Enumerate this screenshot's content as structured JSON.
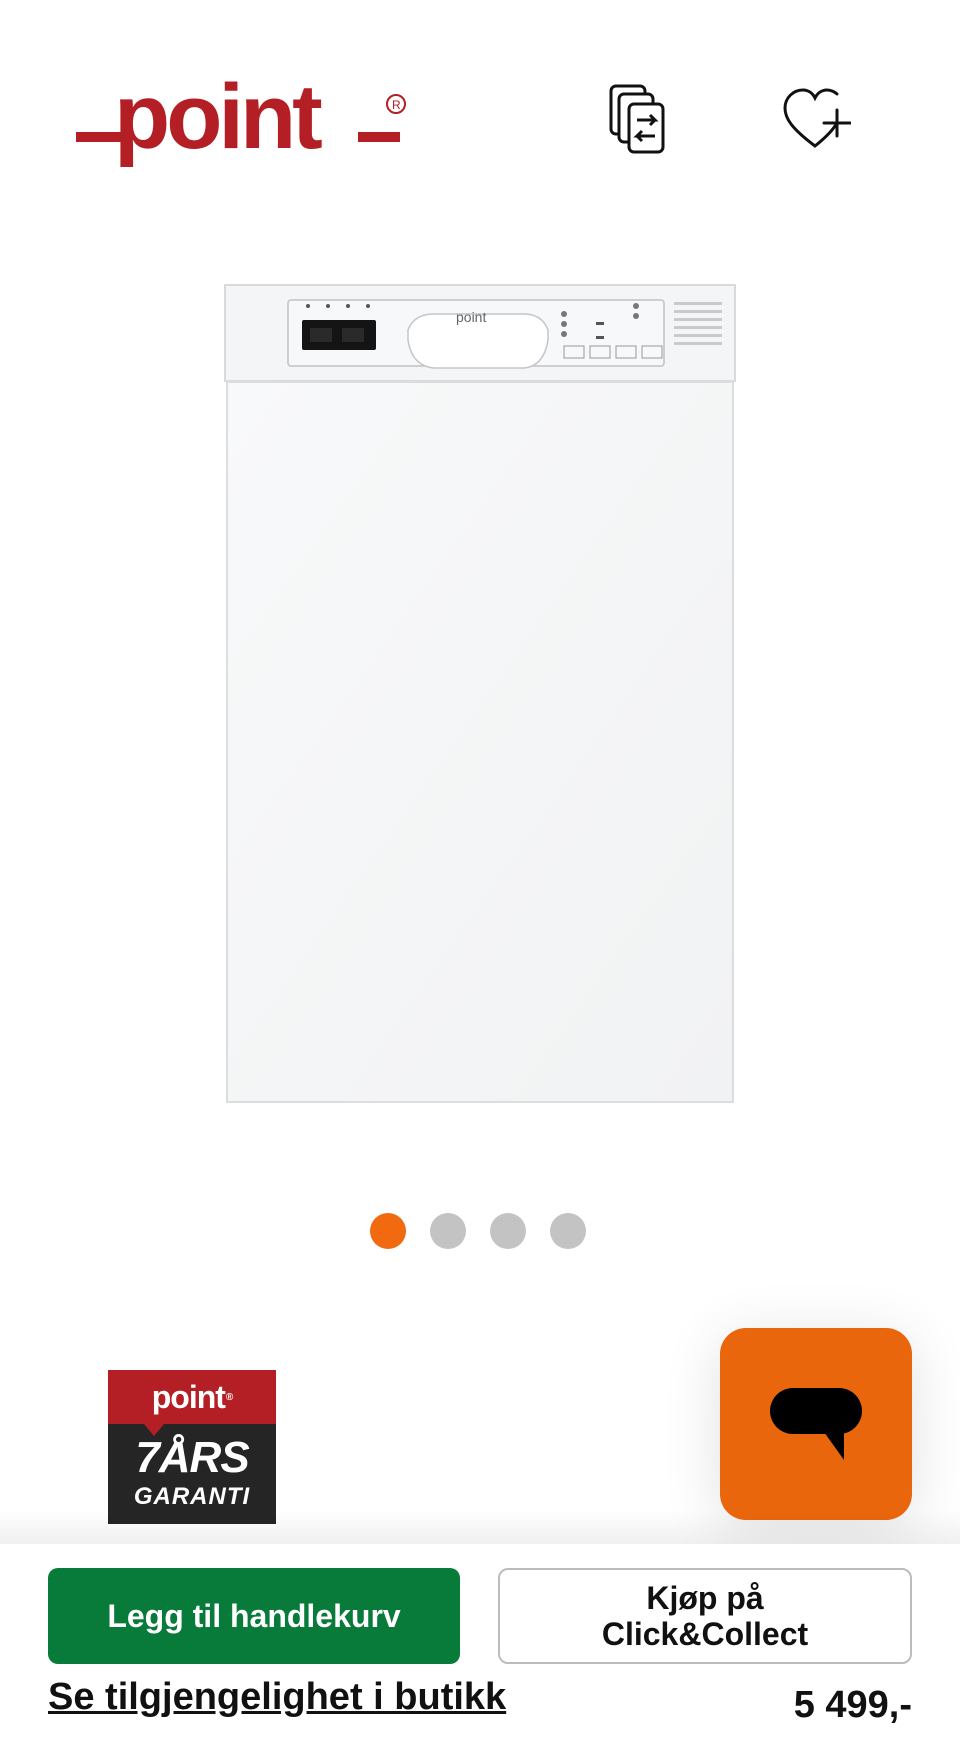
{
  "header": {
    "logo_text": "point",
    "brand_color": "#b31f24",
    "compare_icon": "compare-icon",
    "wishlist_icon": "heart-plus-icon"
  },
  "gallery": {
    "image_label_text": "point",
    "dot_count": 4,
    "active_dot": 1,
    "active_color": "#f26a10",
    "inactive_color": "#c3c3c3"
  },
  "badge": {
    "brand": "point",
    "years": "7ÅRS",
    "garanti": "GARANTI"
  },
  "chat": {
    "icon": "chat-bubble-icon",
    "color": "#ea660c"
  },
  "actions": {
    "add_to_cart": "Legg til handlekurv",
    "click_collect": "Kjøp på Click&Collect",
    "availability_link": "Se tilgjengelighet i butikk",
    "price": "5 499,-",
    "cart_color": "#087a3a"
  }
}
